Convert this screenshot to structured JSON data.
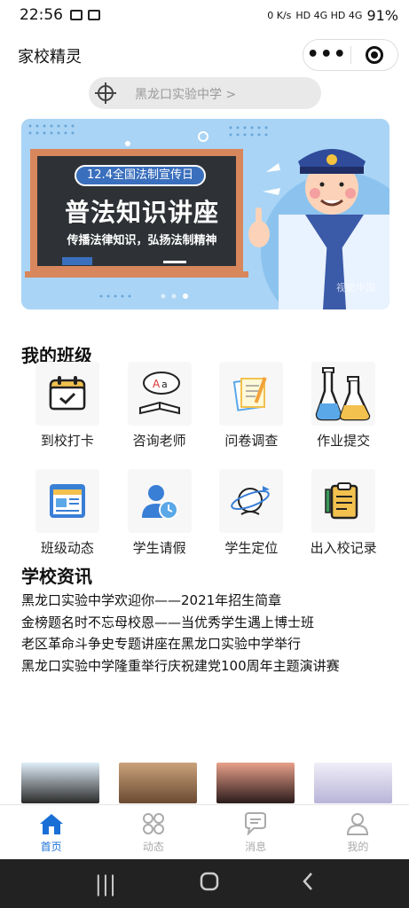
{
  "status": {
    "time": "22:56",
    "net_speed": "0 K/s",
    "signal": "HD 4G HD 4G",
    "battery": "91%"
  },
  "app": {
    "title": "家校精灵"
  },
  "search": {
    "text": "黑龙口实验中学 >"
  },
  "banner": {
    "tag": "12.4全国法制宣传日",
    "heading": "普法知识讲座",
    "slogan": "传播法律知识，弘扬法制精神",
    "watermark": "视觉中国"
  },
  "my_class": {
    "title": "我的班级",
    "items": [
      {
        "label": "到校打卡",
        "icon": "calendar-check-icon"
      },
      {
        "label": "咨询老师",
        "icon": "teacher-book-icon"
      },
      {
        "label": "问卷调查",
        "icon": "survey-notes-icon"
      },
      {
        "label": "作业提交",
        "icon": "flask-icon"
      },
      {
        "label": "班级动态",
        "icon": "newspaper-icon"
      },
      {
        "label": "学生请假",
        "icon": "person-clock-icon"
      },
      {
        "label": "学生定位",
        "icon": "globe-plane-icon"
      },
      {
        "label": "出入校记录",
        "icon": "clipboard-pen-icon"
      }
    ]
  },
  "school_news": {
    "title": "学校资讯",
    "items": [
      "黑龙口实验中学欢迎你——2021年招生简章",
      "金榜题名时不忘母校恩——当优秀学生遇上博士班",
      "老区革命斗争史专题讲座在黑龙口实验中学举行",
      "黑龙口实验中学隆重举行庆祝建党100周年主题演讲赛"
    ]
  },
  "tabs": [
    {
      "label": "首页",
      "icon": "home-icon",
      "active": true
    },
    {
      "label": "动态",
      "icon": "circles-grid-icon",
      "active": false
    },
    {
      "label": "消息",
      "icon": "chat-bubble-icon",
      "active": false
    },
    {
      "label": "我的",
      "icon": "person-icon",
      "active": false
    }
  ],
  "colors": {
    "accent": "#1a6fd6",
    "banner_bg": "#a9d4f5",
    "chalkboard": "#2e3236"
  }
}
